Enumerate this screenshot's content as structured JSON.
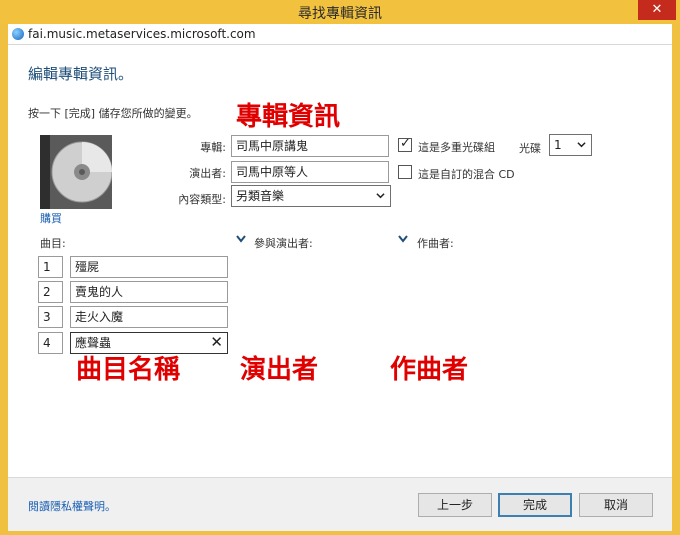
{
  "window": {
    "title": "尋找專輯資訊",
    "close_label": "✕"
  },
  "address": {
    "url": "fai.music.metaservices.microsoft.com"
  },
  "page": {
    "heading": "編輯專輯資訊。",
    "instruction": "按一下 [完成] 儲存您所做的變更。",
    "buy_link": "購買"
  },
  "annotations": {
    "album_info": "專輯資訊",
    "track_name": "曲目名稱",
    "performer": "演出者",
    "composer": "作曲者"
  },
  "form": {
    "album_label": "專輯:",
    "album_value": "司馬中原講鬼",
    "artist_label": "演出者:",
    "artist_value": "司馬中原等人",
    "genre_label": "內容類型:",
    "genre_value": "另類音樂",
    "multidisc_label": "這是多重光碟組",
    "multidisc_checked": true,
    "disc_label": "光碟",
    "disc_value": "1",
    "custom_mix_label": "這是自訂的混合 CD",
    "custom_mix_checked": false
  },
  "columns": {
    "tracks": "曲目:",
    "contributing_artists": "參與演出者:",
    "composer": "作曲者:"
  },
  "tracks": [
    {
      "number": "1",
      "title": "殭屍"
    },
    {
      "number": "2",
      "title": "賣鬼的人"
    },
    {
      "number": "3",
      "title": "走火入魔"
    },
    {
      "number": "4",
      "title": "應聲蟲"
    }
  ],
  "footer": {
    "privacy_link": "閱讀隱私權聲明。",
    "back_button": "上一步",
    "finish_button": "完成",
    "cancel_button": "取消"
  }
}
